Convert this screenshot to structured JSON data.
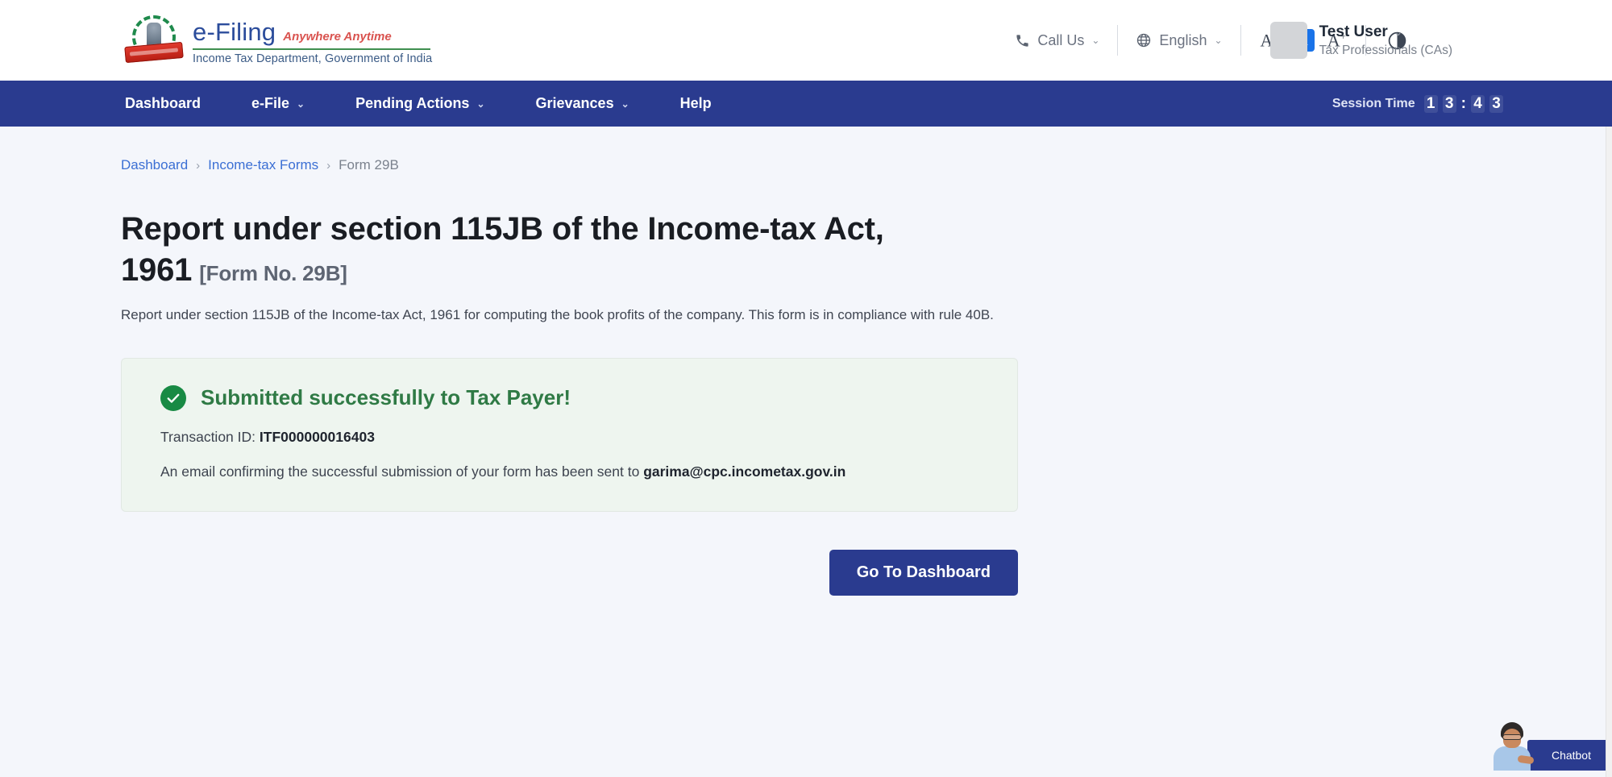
{
  "header": {
    "logo": {
      "brand": "e-Filing",
      "tagline": "Anywhere Anytime",
      "department": "Income Tax Department, Government of India",
      "emblem_icon": "india-emblem-icon"
    },
    "call_us": {
      "label": "Call Us",
      "icon": "phone-icon",
      "chevron": "⌄"
    },
    "language": {
      "label": "English",
      "icon": "globe-icon",
      "chevron": "⌄"
    },
    "font_controls": {
      "decrease": "A",
      "decrease_sup": "−",
      "normal": "A",
      "increase": "A",
      "increase_sup": "+"
    },
    "contrast": {
      "icon": "contrast-icon"
    },
    "user": {
      "name": "Test User",
      "role": "Tax Professionals (CAs)",
      "chevron": "⌄",
      "avatar_icon": "avatar-placeholder-icon"
    }
  },
  "nav": {
    "items": [
      {
        "label": "Dashboard",
        "has_dropdown": false
      },
      {
        "label": "e-File",
        "has_dropdown": true
      },
      {
        "label": "Pending Actions",
        "has_dropdown": true
      },
      {
        "label": "Grievances",
        "has_dropdown": true
      },
      {
        "label": "Help",
        "has_dropdown": false
      }
    ],
    "chevron": "⌄",
    "session": {
      "label": "Session Time",
      "digits": [
        "1",
        "3",
        "4",
        "3"
      ],
      "separator": ":"
    }
  },
  "breadcrumb": {
    "items": [
      {
        "label": "Dashboard",
        "current": false
      },
      {
        "label": "Income-tax Forms",
        "current": false
      },
      {
        "label": "Form 29B",
        "current": true
      }
    ],
    "separator": "›"
  },
  "main": {
    "title": "Report under section 115JB of the Income-tax Act, 1961",
    "title_suffix": "[Form No. 29B]",
    "description": "Report under section 115JB of the Income-tax Act, 1961 for computing the book profits of the company. This form is in compliance with rule 40B.",
    "success": {
      "icon": "check-circle-icon",
      "title": "Submitted successfully to Tax Payer!",
      "transaction_label": "Transaction ID:",
      "transaction_id": "ITF000000016403",
      "email_text": "An email confirming the successful submission of your form has been sent to",
      "email": "garima@cpc.incometax.gov.in"
    },
    "primary_action": "Go To Dashboard"
  },
  "chatbot": {
    "label": "Chatbot",
    "avatar_icon": "chatbot-avatar-icon"
  },
  "colors": {
    "brand_blue": "#2a3b8f",
    "link_blue": "#3b6fd4",
    "success_green": "#2f7a45",
    "check_green": "#188a44",
    "panel_bg": "#eef5ef",
    "page_bg": "#f4f6fb",
    "accent_orange": "#d9534f",
    "font_active_blue": "#1a73e8"
  }
}
